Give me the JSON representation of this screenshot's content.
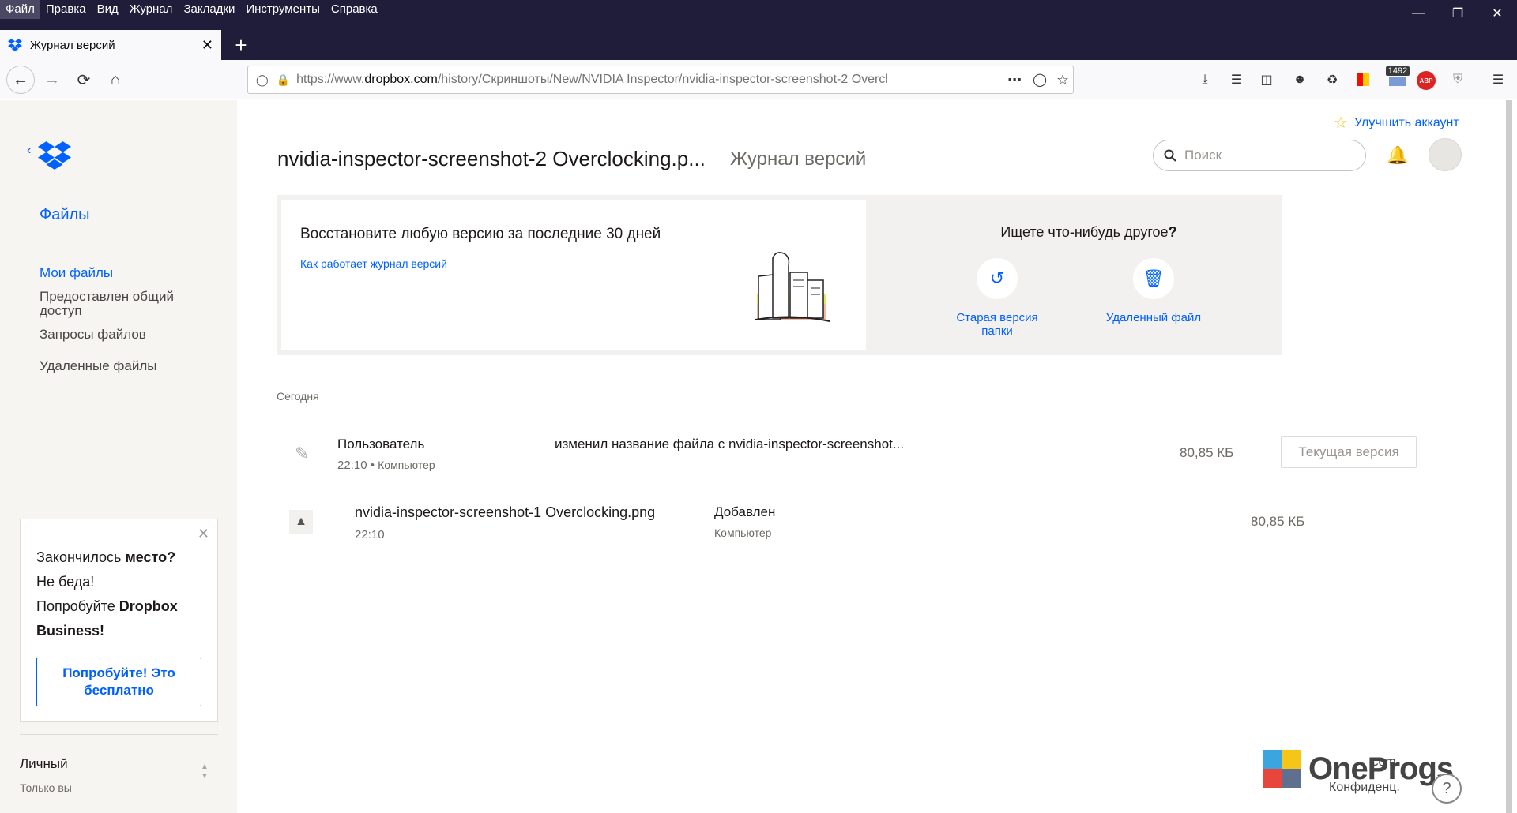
{
  "browser": {
    "menu": [
      "Файл",
      "Правка",
      "Вид",
      "Журнал",
      "Закладки",
      "Инструменты",
      "Справка"
    ],
    "tab_title": "Журнал версий",
    "url_prefix": "https://www.",
    "url_domain": "dropbox.com",
    "url_path": "/history/Скриншоты/New/NVIDIA Inspector/nvidia-inspector-screenshot-2 Overcl",
    "badge_count": "1492",
    "abp_label": "ABP"
  },
  "sidebar": {
    "files_label": "Файлы",
    "items": [
      {
        "label": "Мои файлы",
        "active": true
      },
      {
        "label": "Предоставлен общий доступ",
        "active": false
      },
      {
        "label": "Запросы файлов",
        "active": false
      },
      {
        "label": "Удаленные файлы",
        "active": false
      }
    ],
    "promo": {
      "line1_a": "Закончилось ",
      "line1_b": "место?",
      "line2": "Не беда!",
      "line3_a": "Попробуйте ",
      "line3_b": "Dropbox",
      "line4": "Business!",
      "button": "Попробуйте! Это бесплатно"
    },
    "account": {
      "name": "Личный",
      "subtitle": "Только вы"
    }
  },
  "header": {
    "upgrade": "Улучшить аккаунт",
    "file_title": "nvidia-inspector-screenshot-2 Overclocking.p...",
    "subtitle": "Журнал версий",
    "search_placeholder": "Поиск"
  },
  "banner": {
    "title": "Восстановите любую версию за последние 30 дней",
    "link": "Как работает журнал версий",
    "right_title_a": "Ищете что-нибудь другое",
    "right_title_b": "?",
    "action1": "Старая версия папки",
    "action2": "Удаленный файл"
  },
  "history": {
    "section": "Сегодня",
    "rows": [
      {
        "user": "Пользователь",
        "time": "22:10",
        "device": "Компьютер",
        "description": "изменил название файла с nvidia-inspector-screenshot...",
        "size": "80,85 КБ",
        "button": "Текущая версия"
      },
      {
        "filename": "nvidia-inspector-screenshot-1 Overclocking.png",
        "time": "22:10",
        "action": "Добавлен",
        "device": "Компьютер",
        "size": "80,85 КБ"
      }
    ]
  },
  "watermark": {
    "brand": "OneProgs",
    "tld": ".com",
    "sub": "Конфиденц."
  }
}
